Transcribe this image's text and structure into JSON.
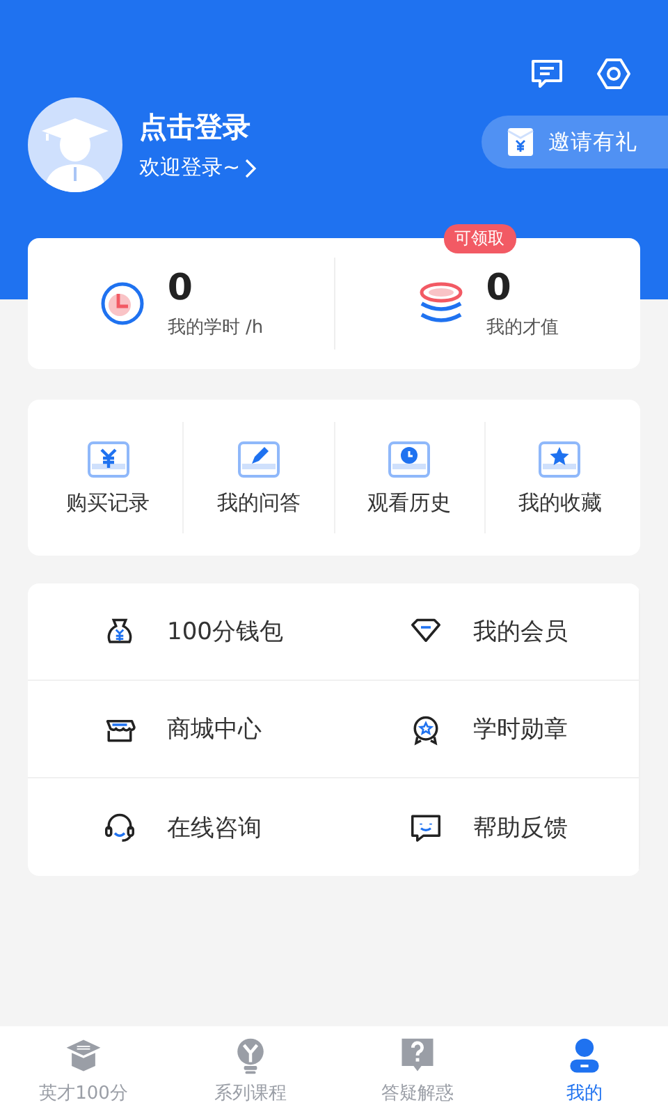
{
  "header": {
    "title": "点击登录",
    "subtitle": "欢迎登录~",
    "invite": "邀请有礼"
  },
  "stats": [
    {
      "kind": "clock",
      "value": "0",
      "label": "我的学时 /h"
    },
    {
      "kind": "coins",
      "value": "0",
      "label": "我的才值",
      "badge": "可领取"
    }
  ],
  "shortcuts": [
    {
      "kind": "yen",
      "label": "购买记录"
    },
    {
      "kind": "pen",
      "label": "我的问答"
    },
    {
      "kind": "clock",
      "label": "观看历史"
    },
    {
      "kind": "star",
      "label": "我的收藏"
    }
  ],
  "services": [
    {
      "kind": "bag",
      "label": "100分钱包"
    },
    {
      "kind": "diamond",
      "label": "我的会员"
    },
    {
      "kind": "store",
      "label": "商城中心"
    },
    {
      "kind": "medal",
      "label": "学时勋章"
    },
    {
      "kind": "headset",
      "label": "在线咨询"
    },
    {
      "kind": "smile",
      "label": "帮助反馈"
    }
  ],
  "tabs": [
    {
      "kind": "cap",
      "label": "英才100分",
      "selected": false
    },
    {
      "kind": "bulb",
      "label": "系列课程",
      "selected": false
    },
    {
      "kind": "question",
      "label": "答疑解惑",
      "selected": false
    },
    {
      "kind": "person",
      "label": "我的",
      "selected": true
    }
  ]
}
